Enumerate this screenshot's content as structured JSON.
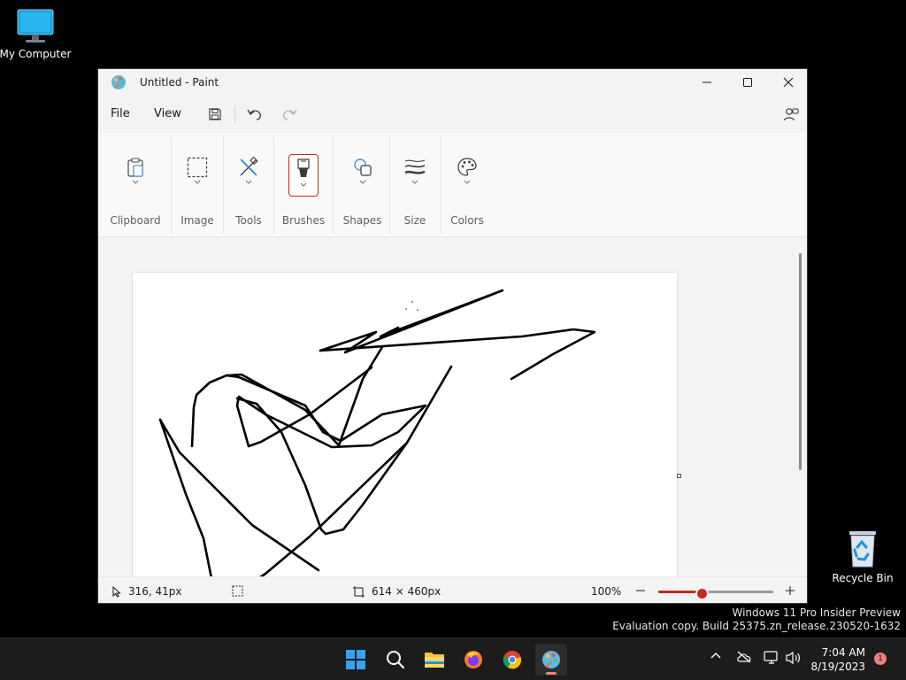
{
  "desktop": {
    "icons": [
      {
        "label": "My Computer"
      },
      {
        "label": "Recycle Bin"
      }
    ],
    "watermark": {
      "line1": "Windows 11 Pro Insider Preview",
      "line2": "Evaluation copy. Build 25375.zn_release.230520-1632"
    }
  },
  "window": {
    "title": "Untitled - Paint",
    "menu": {
      "file": "File",
      "view": "View"
    },
    "ribbon": {
      "groups": [
        {
          "label": "Clipboard",
          "icon": "clipboard-icon"
        },
        {
          "label": "Image",
          "icon": "selection-icon"
        },
        {
          "label": "Tools",
          "icon": "tools-icon"
        },
        {
          "label": "Brushes",
          "icon": "brush-icon",
          "selected": true
        },
        {
          "label": "Shapes",
          "icon": "shapes-icon"
        },
        {
          "label": "Size",
          "icon": "size-icon"
        },
        {
          "label": "Colors",
          "icon": "palette-icon"
        }
      ]
    },
    "status": {
      "cursor_position": "316, 41px",
      "canvas_size": "614 × 460px",
      "zoom": "100%",
      "zoom_slider_fraction": 0.38
    }
  },
  "taskbar": {
    "apps": [
      "start-icon",
      "search-icon",
      "file-explorer-icon",
      "firefox-icon",
      "chrome-icon",
      "paint-icon"
    ],
    "time": "7:04 AM",
    "date": "8/19/2023",
    "notification_count": "1"
  },
  "colors": {
    "accent": "#c42b1c",
    "taskbar": "#1c1c1c",
    "window_bg": "#f3f3f3"
  }
}
